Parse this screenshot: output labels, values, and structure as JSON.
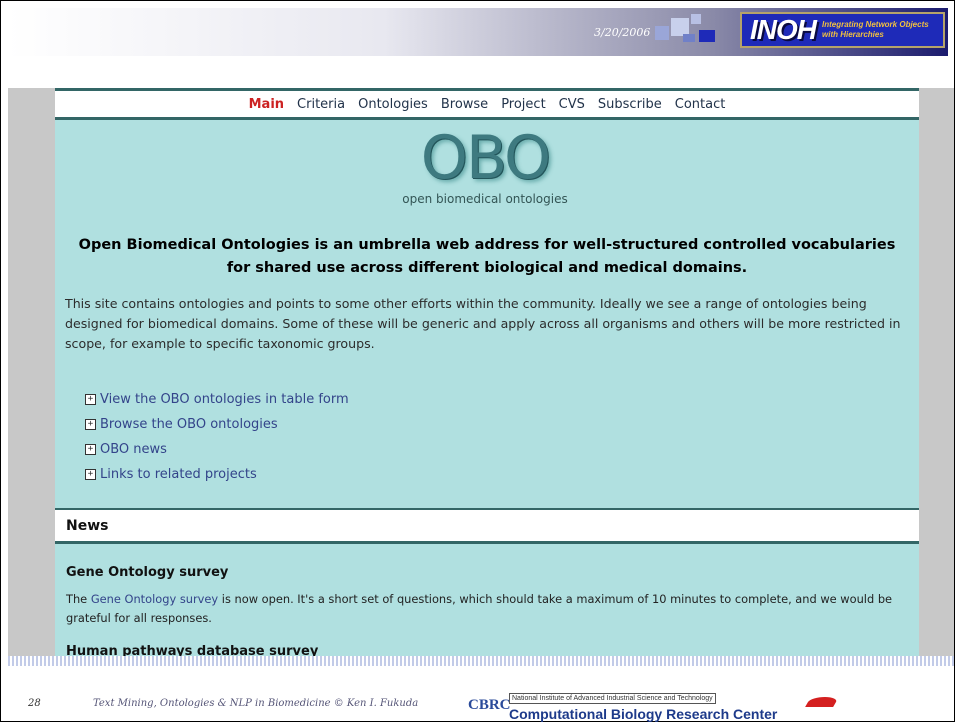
{
  "slide": {
    "date": "3/20/2006",
    "page_number": "28",
    "footer_title": "Text Mining, Ontologies & NLP in Biomedicine © Ken I. Fukuda",
    "header_logo": "INOH",
    "header_logo_tagline": "Integrating Network Objects with Hierarchies",
    "footer_org_small": "National Institute of Advanced Industrial Science and Technology",
    "footer_org_name": "Computational Biology Research Center",
    "footer_org_abbr": "CBRC"
  },
  "nav": {
    "items": [
      "Main",
      "Criteria",
      "Ontologies",
      "Browse",
      "Project",
      "CVS",
      "Subscribe",
      "Contact"
    ],
    "active": "Main"
  },
  "logo": {
    "text": "OBO",
    "subtitle": "open biomedical ontologies"
  },
  "intro": {
    "heading": "Open Biomedical Ontologies is an umbrella web address for well-structured controlled vocabularies for shared use across different biological and medical domains.",
    "body": "This site contains ontologies and points to some other efforts within the community. Ideally we see a range of ontologies being designed for biomedical domains. Some of these will be generic and apply across all organisms and others will be more restricted in scope, for example to specific taxonomic groups."
  },
  "links": [
    "View the OBO ontologies in table form",
    "Browse the OBO ontologies",
    "OBO news",
    "Links to related projects"
  ],
  "news": {
    "heading": "News",
    "item1_title": "Gene Ontology survey",
    "item1_pre": "The ",
    "item1_link": "Gene Ontology survey",
    "item1_post": " is now open. It's a short set of questions, which should take a maximum of 10 minutes to complete, and we would be grateful for all responses.",
    "item2_title": "Human pathways database survey"
  },
  "colors": {
    "page_bg": "#b0e0e0",
    "nav_active": "#cc2222",
    "link": "#33448a",
    "rule": "#336666"
  }
}
